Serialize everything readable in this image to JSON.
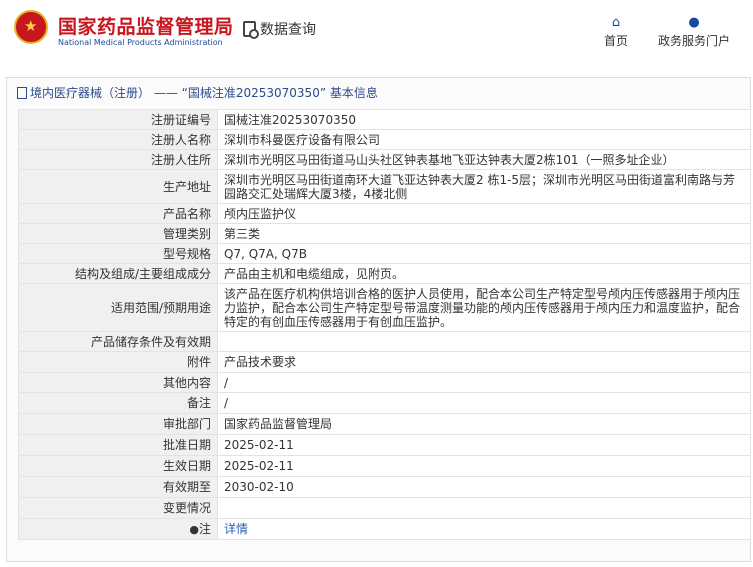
{
  "header": {
    "site_name": "国家药品监督管理局",
    "site_name_en": "National Medical Products Administration",
    "query_label": "数据查询",
    "nav": [
      {
        "label": "首页",
        "icon": "home-icon"
      },
      {
        "label": "政务服务门户",
        "icon": "user-icon"
      }
    ]
  },
  "panel": {
    "title": "境内医疗器械（注册） —— “国械注准20253070350” 基本信息"
  },
  "rows": [
    {
      "label": "注册证编号",
      "value": "国械注准20253070350"
    },
    {
      "label": "注册人名称",
      "value": "深圳市科曼医疗设备有限公司"
    },
    {
      "label": "注册人住所",
      "value": "深圳市光明区马田街道马山头社区钟表基地飞亚达钟表大厦2栋101（一照多址企业）"
    },
    {
      "label": "生产地址",
      "value": "深圳市光明区马田街道南环大道飞亚达钟表大厦2 栋1-5层；深圳市光明区马田街道富利南路与芳园路交汇处瑞辉大厦3楼，4楼北侧"
    },
    {
      "label": "产品名称",
      "value": "颅内压监护仪"
    },
    {
      "label": "管理类别",
      "value": "第三类"
    },
    {
      "label": "型号规格",
      "value": "Q7, Q7A, Q7B"
    },
    {
      "label": "结构及组成/主要组成成分",
      "value": "产品由主机和电缆组成，见附页。"
    },
    {
      "label": "适用范围/预期用途",
      "value": "该产品在医疗机构供培训合格的医护人员使用，配合本公司生产特定型号颅内压传感器用于颅内压力监护，配合本公司生产特定型号带温度测量功能的颅内压传感器用于颅内压力和温度监护，配合特定的有创血压传感器用于有创血压监护。"
    },
    {
      "label": "产品储存条件及有效期",
      "value": ""
    },
    {
      "label": "附件",
      "value": "产品技术要求"
    },
    {
      "label": "其他内容",
      "value": "/"
    },
    {
      "label": "备注",
      "value": "/"
    },
    {
      "label": "审批部门",
      "value": "国家药品监督管理局"
    },
    {
      "label": "批准日期",
      "value": "2025-02-11"
    },
    {
      "label": "生效日期",
      "value": "2025-02-11"
    },
    {
      "label": "有效期至",
      "value": "2030-02-10"
    },
    {
      "label": "变更情况",
      "value": ""
    }
  ],
  "note": {
    "label": "注",
    "link_text": "详情",
    "icon": "bulb-icon"
  },
  "colors": {
    "brand_red": "#c8161e",
    "link_blue": "#2d63b8",
    "title_blue": "#2d4a8c"
  }
}
